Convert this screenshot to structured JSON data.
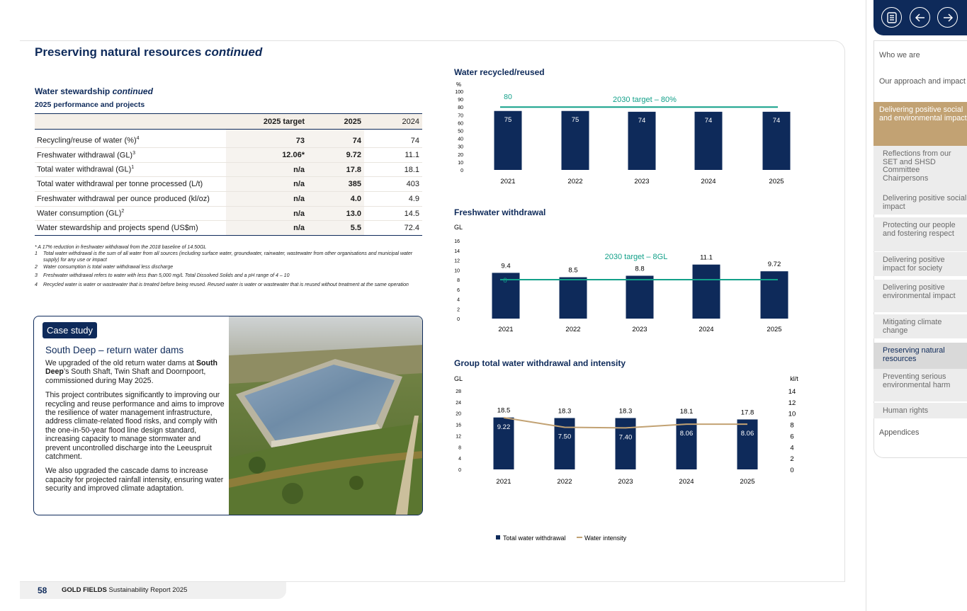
{
  "page": {
    "title_main": "Preserving natural resources",
    "title_italic": "continued"
  },
  "left": {
    "section_title_main": "Water stewardship",
    "section_title_italic": "continued",
    "sub_title": "2025 performance and projects",
    "table": {
      "headers": [
        "",
        "2025 target",
        "2025",
        "2024"
      ],
      "rows": [
        {
          "label": "Recycling/reuse of water (%)",
          "sup": "4",
          "target": "73",
          "y2025": "74",
          "y2024": "74"
        },
        {
          "label": "Freshwater withdrawal (GL)",
          "sup": "3",
          "target": "12.06*",
          "y2025": "9.72",
          "y2024": "11.1"
        },
        {
          "label": "Total water withdrawal (GL)",
          "sup": "1",
          "target": "n/a",
          "y2025": "17.8",
          "y2024": "18.1"
        },
        {
          "label": "Total water withdrawal per tonne processed (L/t)",
          "sup": "",
          "target": "n/a",
          "y2025": "385",
          "y2024": "403"
        },
        {
          "label": "Freshwater withdrawal per ounce produced (kl/oz)",
          "sup": "",
          "target": "n/a",
          "y2025": "4.0",
          "y2024": "4.9"
        },
        {
          "label": "Water consumption (GL)",
          "sup": "2",
          "target": "n/a",
          "y2025": "13.0",
          "y2024": "14.5"
        },
        {
          "label": "Water stewardship and projects spend (US$m)",
          "sup": "",
          "target": "n/a",
          "y2025": "5.5",
          "y2024": "72.4"
        }
      ]
    },
    "footnotes": [
      {
        "mark": "*",
        "text": "A 17% reduction in freshwater withdrawal from the 2018 baseline of 14.50GL"
      },
      {
        "mark": "1",
        "text": "Total water withdrawal is the sum of all water from all sources (including surface water, groundwater, rainwater, wastewater from other organisations and municipal water supply) for any use or impact"
      },
      {
        "mark": "2",
        "text": "Water consumption is total water withdrawal less discharge"
      },
      {
        "mark": "3",
        "text": "Freshwater withdrawal refers to water with less than 5,000 mg/L Total Dissolved Solids and a pH range of 4 – 10"
      },
      {
        "mark": "4",
        "text": "Recycled water is water or wastewater that is treated before being reused. Reused water is water or wastewater that is reused without treatment at the same operation"
      }
    ]
  },
  "case_study": {
    "tag": "Case study",
    "heading": "South Deep – return water dams",
    "p1_a": "We upgraded of the old return water dams at ",
    "p1_bold": "South Deep",
    "p1_b": "’s South Shaft, Twin Shaft and Doornpoort, commissioned during May 2025.",
    "p2": "This project contributes significantly to improving our recycling and reuse performance and aims to improve the resilience of water management infrastructure, address climate-related flood risks, and comply with the one-in-50-year flood line design standard, increasing capacity to manage stormwater and prevent uncontrolled discharge into the Leeuspruit catchment.",
    "p3": "We also upgraded the cascade dams to increase capacity for projected rainfall intensity, ensuring water security and improved climate adaptation."
  },
  "chart_data": [
    {
      "type": "bar",
      "title": "Water recycled/reused",
      "ylabel": "%",
      "categories": [
        "2021",
        "2022",
        "2023",
        "2024",
        "2025"
      ],
      "values": [
        75,
        75,
        74,
        74,
        74
      ],
      "ylim": [
        0,
        100
      ],
      "yticks": [
        0,
        10,
        20,
        30,
        40,
        50,
        60,
        70,
        80,
        90,
        100
      ],
      "target": {
        "value": 80,
        "label": "2030 target – 80%",
        "value_label": "80"
      }
    },
    {
      "type": "bar",
      "title": "Freshwater withdrawal",
      "ylabel": "GL",
      "categories": [
        "2021",
        "2022",
        "2023",
        "2024",
        "2025"
      ],
      "values": [
        9.4,
        8.5,
        8.8,
        11.1,
        9.72
      ],
      "value_labels": [
        "9.4",
        "8.5",
        "8.8",
        "11.1",
        "9.72"
      ],
      "ylim": [
        0,
        16
      ],
      "yticks": [
        0,
        2,
        4,
        6,
        8,
        10,
        12,
        14,
        16
      ],
      "target": {
        "value": 8,
        "label": "2030 target – 8GL",
        "value_label": "8"
      }
    },
    {
      "type": "bar",
      "title": "Group total water withdrawal and intensity",
      "ylabel": "GL",
      "ylabel_right": "kl/t",
      "categories": [
        "2021",
        "2022",
        "2023",
        "2024",
        "2025"
      ],
      "series": [
        {
          "name": "Total water withdrawal",
          "values": [
            18.5,
            18.3,
            18.3,
            18.1,
            17.8
          ],
          "labels": [
            "18.5",
            "18.3",
            "18.3",
            "18.1",
            "17.8"
          ]
        },
        {
          "name": "Water intensity",
          "values": [
            9.22,
            7.5,
            7.4,
            8.06,
            8.06
          ],
          "labels": [
            "9.22",
            "7.50",
            "7.40",
            "8.06",
            "8.06"
          ]
        }
      ],
      "ylim": [
        0,
        28
      ],
      "yticks": [
        0,
        4,
        8,
        12,
        16,
        20,
        24,
        28
      ],
      "ylim_right": [
        0,
        14
      ],
      "yticks_right": [
        0,
        2,
        4,
        6,
        8,
        10,
        12,
        14
      ],
      "legend": "bottom"
    }
  ],
  "colors": {
    "navy": "#0e2a5a",
    "teal": "#12a089",
    "tan": "#c2a273"
  },
  "footer": {
    "page_number": "58",
    "brand": "GOLD FIELDS",
    "report": "Sustainability Report 2025"
  },
  "nav": {
    "icons": [
      "contents-icon",
      "arrow-left-icon",
      "arrow-right-icon"
    ]
  },
  "sidebar": [
    {
      "label": "Who we are",
      "kind": "main"
    },
    {
      "label": "Our approach and impact",
      "kind": "main"
    },
    {
      "label": "Delivering positive social and environmental impact",
      "kind": "active-main"
    },
    {
      "label": "Reflections from our SET and SHSD Committee Chairpersons",
      "kind": "sub"
    },
    {
      "label": "Delivering positive social impact",
      "kind": "sub"
    },
    {
      "label": "Protecting our people and fostering respect",
      "kind": "sub"
    },
    {
      "label": "Delivering positive impact for society",
      "kind": "sub"
    },
    {
      "label": "Delivering positive environmental impact",
      "kind": "sub"
    },
    {
      "label": "Mitigating climate change",
      "kind": "sub"
    },
    {
      "label": "Preserving natural resources",
      "kind": "active-sub"
    },
    {
      "label": "Preventing serious environmental harm",
      "kind": "sub"
    },
    {
      "label": "Human rights",
      "kind": "sub"
    },
    {
      "label": "Appendices",
      "kind": "main"
    }
  ]
}
